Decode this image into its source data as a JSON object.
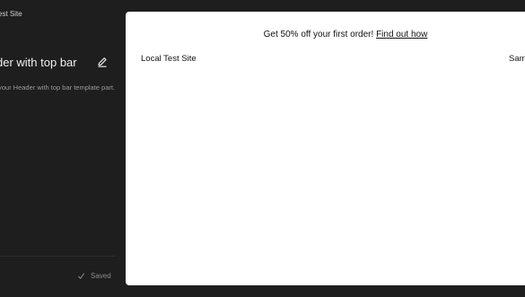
{
  "sidebar": {
    "site_title": "est Site",
    "panel_title": "der with top bar",
    "panel_description": "your Header with top bar template part.",
    "edit_icon": "pencil-icon",
    "saved_icon": "checkmark-icon",
    "saved_label": "Saved"
  },
  "canvas": {
    "topbar_text": "Get 50% off your first order!",
    "topbar_link": "Find out how",
    "site_title": "Local Test Site",
    "nav_item": "Samp"
  }
}
